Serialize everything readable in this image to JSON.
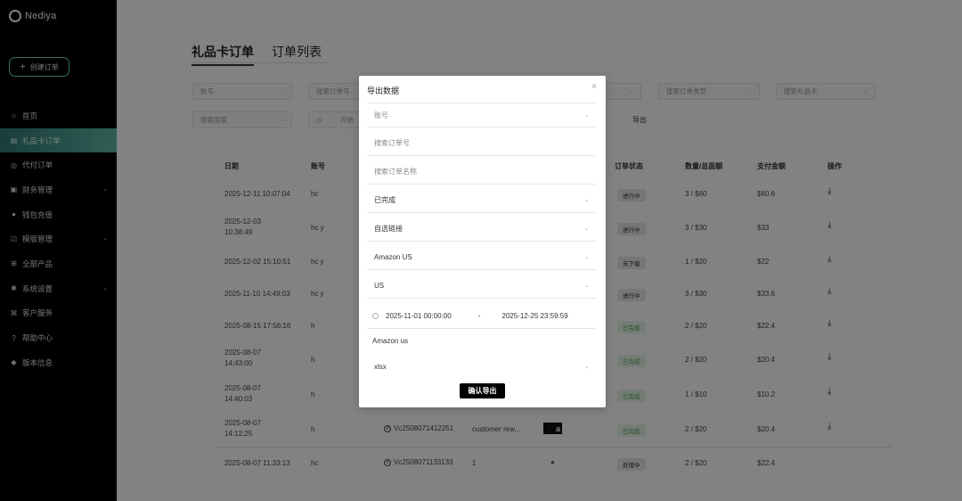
{
  "sidebar": {
    "brand": "Nediya",
    "create_label": "创建订单",
    "items": [
      {
        "label": "首页",
        "icon": "home-icon"
      },
      {
        "label": "礼品卡订单",
        "icon": "gift-card-icon"
      },
      {
        "label": "代付订单",
        "icon": "payment-icon"
      },
      {
        "label": "财务管理",
        "icon": "finance-icon"
      },
      {
        "label": "钱包充值",
        "icon": "wallet-icon"
      },
      {
        "label": "模版管理",
        "icon": "template-icon"
      },
      {
        "label": "全部产品",
        "icon": "products-icon"
      },
      {
        "label": "系统设置",
        "icon": "gear-icon"
      },
      {
        "label": "客户服务",
        "icon": "support-icon"
      },
      {
        "label": "帮助中心",
        "icon": "help-icon"
      },
      {
        "label": "版本信息",
        "icon": "version-icon"
      }
    ]
  },
  "tabs": [
    {
      "label": "礼品卡订单"
    },
    {
      "label": "订单列表"
    }
  ],
  "filters": {
    "account": "账号",
    "order_no": "搜索订单号",
    "order_type": "搜索订单类型",
    "gift_card": "搜索礼品卡",
    "country": "搜索国家",
    "start": "开始",
    "export": "导出"
  },
  "table": {
    "headers": [
      "日期",
      "账号",
      "订单状态",
      "数量/总面额",
      "支付金额",
      "操作"
    ],
    "rows": [
      {
        "date": "2025-12-11 10:07:04",
        "account": "hc",
        "status": "进行中",
        "qty": "3 / $60",
        "amount": "$60.6"
      },
      {
        "date": "2025-12-03\n10:38:49",
        "account": "hc y",
        "status": "进行中",
        "qty": "3 / $30",
        "amount": "$33"
      },
      {
        "date": "2025-12-02 15:10:51",
        "account": "hc y",
        "status": "未下载",
        "qty": "1 / $20",
        "amount": "$22"
      },
      {
        "date": "2025-11-10 14:49:03",
        "account": "hc y",
        "status": "进行中",
        "qty": "3 / $30",
        "amount": "$33.6"
      },
      {
        "date": "2025-08-15 17:56:16",
        "account": "h",
        "status": "已完成",
        "qty": "2 / $20",
        "amount": "$22.4"
      },
      {
        "date": "2025-08-07\n14:43:00",
        "account": "h",
        "status": "已完成",
        "qty": "2 / $20",
        "amount": "$20.4"
      },
      {
        "date": "2025-08-07\n14:40:03",
        "account": "h",
        "status": "已完成",
        "qty": "1 / $10",
        "amount": "$10.2"
      },
      {
        "date": "2025-08-07\n14:12:25",
        "account": "h",
        "status": "已完成",
        "qty": "2 / $20",
        "amount": "$20.4",
        "order": "Vc2508071412251",
        "name": "customer rew..."
      },
      {
        "date": "2025-08-07 11:33:13",
        "account": "hc",
        "status": "处理中",
        "qty": "2 / $20",
        "amount": "$22.4",
        "order": "Vc2508071133133",
        "name": "1"
      }
    ]
  },
  "modal": {
    "title": "导出数据",
    "account": "账号",
    "order_no_placeholder": "搜索订单号",
    "order_name_placeholder": "搜索订单名称",
    "status": "已完成",
    "link_type": "自选链接",
    "card": "Amazon US",
    "country": "US",
    "date_start": "2025-11-01 00:00:00",
    "date_sep": "-",
    "date_end": "2025-12-25 23:59:59",
    "static_label": "Amazon us",
    "format": "xlsx",
    "confirm": "确认导出"
  }
}
